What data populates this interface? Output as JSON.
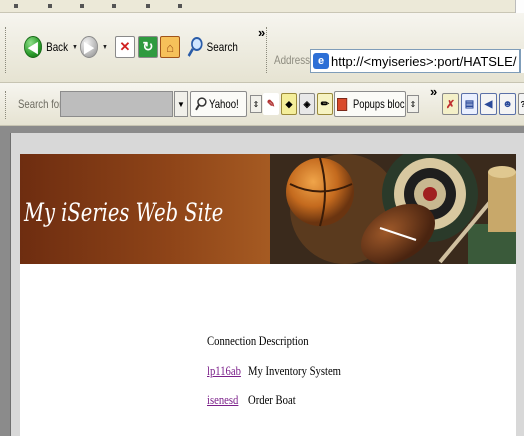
{
  "toolbar": {
    "back_label": "Back",
    "search_label": "Search",
    "chevron": "»"
  },
  "address_bar": {
    "label": "Address",
    "url": "http://<myiseries>:port/HATSLE/"
  },
  "search_bar": {
    "label": "Search for",
    "engine": "Yahoo!",
    "popup_status": "Popups blocked",
    "chevron": "»"
  },
  "page": {
    "banner_title": "My iSeries Web Site",
    "table_header": "Connection Description",
    "connections": [
      {
        "name": "lp116ab",
        "description": "My Inventory System"
      },
      {
        "name": "isenesd",
        "description": "Order Boat"
      }
    ]
  },
  "colors": {
    "link": "#7b1f8a",
    "chrome": "#ece9d8",
    "banner_brown": "#8e4418"
  }
}
